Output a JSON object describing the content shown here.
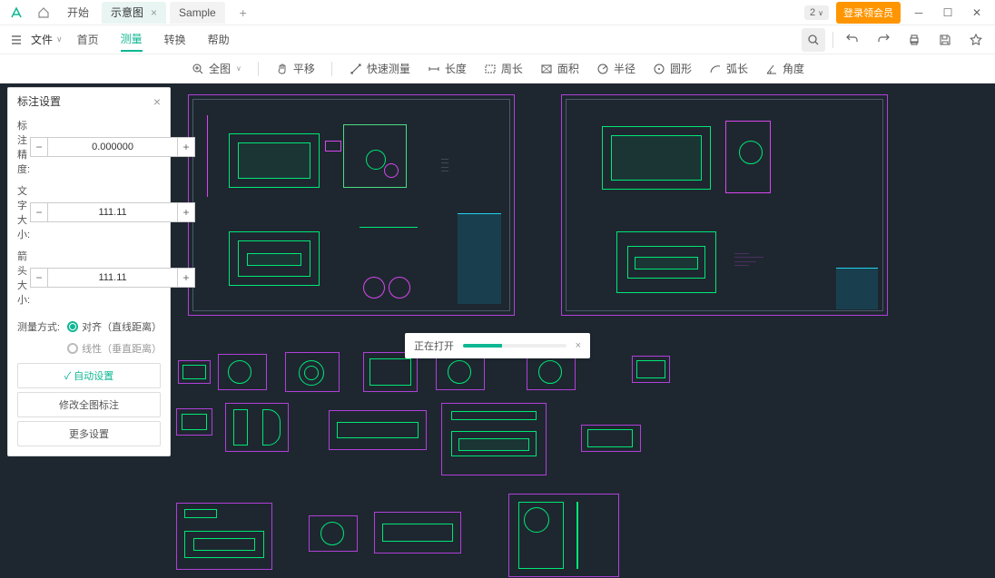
{
  "titlebar": {
    "tab_start": "开始",
    "tab_active": "示意图",
    "tab_sample": "Sample",
    "version": "2",
    "login": "登录领会员"
  },
  "menubar": {
    "file": "文件",
    "items": [
      "首页",
      "测量",
      "转换",
      "帮助"
    ],
    "active_index": 1
  },
  "toolbar": {
    "fit": "全图",
    "pan": "平移",
    "quick": "快速测量",
    "length": "长度",
    "perimeter": "周长",
    "area": "面积",
    "radius": "半径",
    "circle": "圆形",
    "arc": "弧长",
    "angle": "角度"
  },
  "panel": {
    "title": "标注设置",
    "precision_label": "标注精度:",
    "precision_value": "0.000000",
    "textsize_label": "文字大小:",
    "textsize_value": "111.11",
    "arrowsize_label": "箭头大小:",
    "arrowsize_value": "111.11",
    "method_label": "测量方式:",
    "method_align": "对齐（直线距离）",
    "method_linear": "线性（垂直距离）",
    "auto": "自动设置",
    "modify": "修改全图标注",
    "more": "更多设置"
  },
  "toast": {
    "text": "正在打开"
  }
}
